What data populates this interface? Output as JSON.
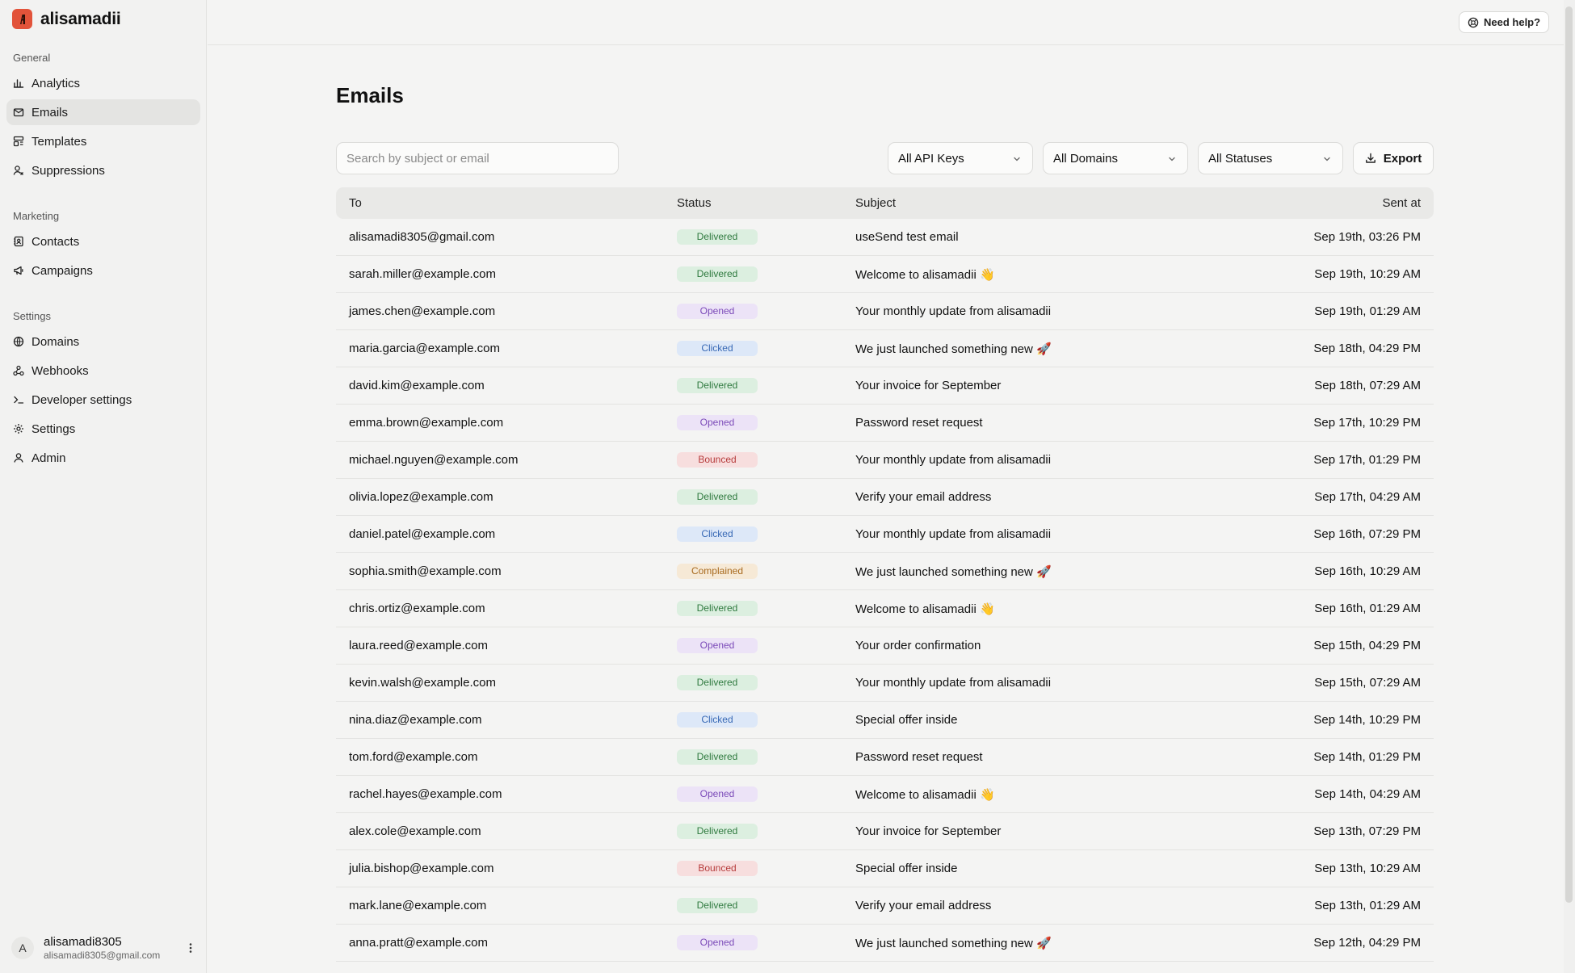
{
  "app": {
    "name": "alisamadii"
  },
  "sidebar": {
    "sections": [
      {
        "heading": "General",
        "items": [
          {
            "label": "Analytics",
            "icon": "bar-chart-icon"
          },
          {
            "label": "Emails",
            "icon": "mail-icon",
            "active": true
          },
          {
            "label": "Templates",
            "icon": "layout-template-icon"
          },
          {
            "label": "Suppressions",
            "icon": "user-x-icon"
          }
        ]
      },
      {
        "heading": "Marketing",
        "items": [
          {
            "label": "Contacts",
            "icon": "contacts-book-icon"
          },
          {
            "label": "Campaigns",
            "icon": "megaphone-icon"
          }
        ]
      },
      {
        "heading": "Settings",
        "items": [
          {
            "label": "Domains",
            "icon": "globe-icon"
          },
          {
            "label": "Webhooks",
            "icon": "webhook-icon"
          },
          {
            "label": "Developer settings",
            "icon": "terminal-icon"
          },
          {
            "label": "Settings",
            "icon": "gear-icon"
          },
          {
            "label": "Admin",
            "icon": "user-icon"
          }
        ]
      }
    ],
    "user": {
      "initial": "A",
      "name": "alisamadi8305",
      "email": "alisamadi8305@gmail.com"
    }
  },
  "topbar": {
    "help_label": "Need help?"
  },
  "page": {
    "title": "Emails"
  },
  "filters": {
    "search_placeholder": "Search by subject or email",
    "api_keys": "All API Keys",
    "domains": "All Domains",
    "statuses": "All Statuses",
    "export_label": "Export"
  },
  "table": {
    "columns": {
      "to": "To",
      "status": "Status",
      "subject": "Subject",
      "sent_at": "Sent at"
    },
    "rows": [
      {
        "to": "alisamadi8305@gmail.com",
        "status": "Delivered",
        "subject": "useSend test email",
        "sent_at": "Sep 19th, 03:26 PM"
      },
      {
        "to": "sarah.miller@example.com",
        "status": "Delivered",
        "subject": "Welcome to alisamadii 👋",
        "sent_at": "Sep 19th, 10:29 AM"
      },
      {
        "to": "james.chen@example.com",
        "status": "Opened",
        "subject": "Your monthly update from alisamadii",
        "sent_at": "Sep 19th, 01:29 AM"
      },
      {
        "to": "maria.garcia@example.com",
        "status": "Clicked",
        "subject": "We just launched something new 🚀",
        "sent_at": "Sep 18th, 04:29 PM"
      },
      {
        "to": "david.kim@example.com",
        "status": "Delivered",
        "subject": "Your invoice for September",
        "sent_at": "Sep 18th, 07:29 AM"
      },
      {
        "to": "emma.brown@example.com",
        "status": "Opened",
        "subject": "Password reset request",
        "sent_at": "Sep 17th, 10:29 PM"
      },
      {
        "to": "michael.nguyen@example.com",
        "status": "Bounced",
        "subject": "Your monthly update from alisamadii",
        "sent_at": "Sep 17th, 01:29 PM"
      },
      {
        "to": "olivia.lopez@example.com",
        "status": "Delivered",
        "subject": "Verify your email address",
        "sent_at": "Sep 17th, 04:29 AM"
      },
      {
        "to": "daniel.patel@example.com",
        "status": "Clicked",
        "subject": "Your monthly update from alisamadii",
        "sent_at": "Sep 16th, 07:29 PM"
      },
      {
        "to": "sophia.smith@example.com",
        "status": "Complained",
        "subject": "We just launched something new 🚀",
        "sent_at": "Sep 16th, 10:29 AM"
      },
      {
        "to": "chris.ortiz@example.com",
        "status": "Delivered",
        "subject": "Welcome to alisamadii 👋",
        "sent_at": "Sep 16th, 01:29 AM"
      },
      {
        "to": "laura.reed@example.com",
        "status": "Opened",
        "subject": "Your order confirmation",
        "sent_at": "Sep 15th, 04:29 PM"
      },
      {
        "to": "kevin.walsh@example.com",
        "status": "Delivered",
        "subject": "Your monthly update from alisamadii",
        "sent_at": "Sep 15th, 07:29 AM"
      },
      {
        "to": "nina.diaz@example.com",
        "status": "Clicked",
        "subject": "Special offer inside",
        "sent_at": "Sep 14th, 10:29 PM"
      },
      {
        "to": "tom.ford@example.com",
        "status": "Delivered",
        "subject": "Password reset request",
        "sent_at": "Sep 14th, 01:29 PM"
      },
      {
        "to": "rachel.hayes@example.com",
        "status": "Opened",
        "subject": "Welcome to alisamadii 👋",
        "sent_at": "Sep 14th, 04:29 AM"
      },
      {
        "to": "alex.cole@example.com",
        "status": "Delivered",
        "subject": "Your invoice for September",
        "sent_at": "Sep 13th, 07:29 PM"
      },
      {
        "to": "julia.bishop@example.com",
        "status": "Bounced",
        "subject": "Special offer inside",
        "sent_at": "Sep 13th, 10:29 AM"
      },
      {
        "to": "mark.lane@example.com",
        "status": "Delivered",
        "subject": "Verify your email address",
        "sent_at": "Sep 13th, 01:29 AM"
      },
      {
        "to": "anna.pratt@example.com",
        "status": "Opened",
        "subject": "We just launched something new 🚀",
        "sent_at": "Sep 12th, 04:29 PM"
      }
    ]
  },
  "colors": {
    "brand": "#e2533a",
    "active_nav": "#e4e4e2",
    "delivered": "#2f7a3f",
    "opened": "#7b4ab8",
    "clicked": "#3869b5",
    "bounced": "#b63c3c",
    "complained": "#a86a1e"
  }
}
